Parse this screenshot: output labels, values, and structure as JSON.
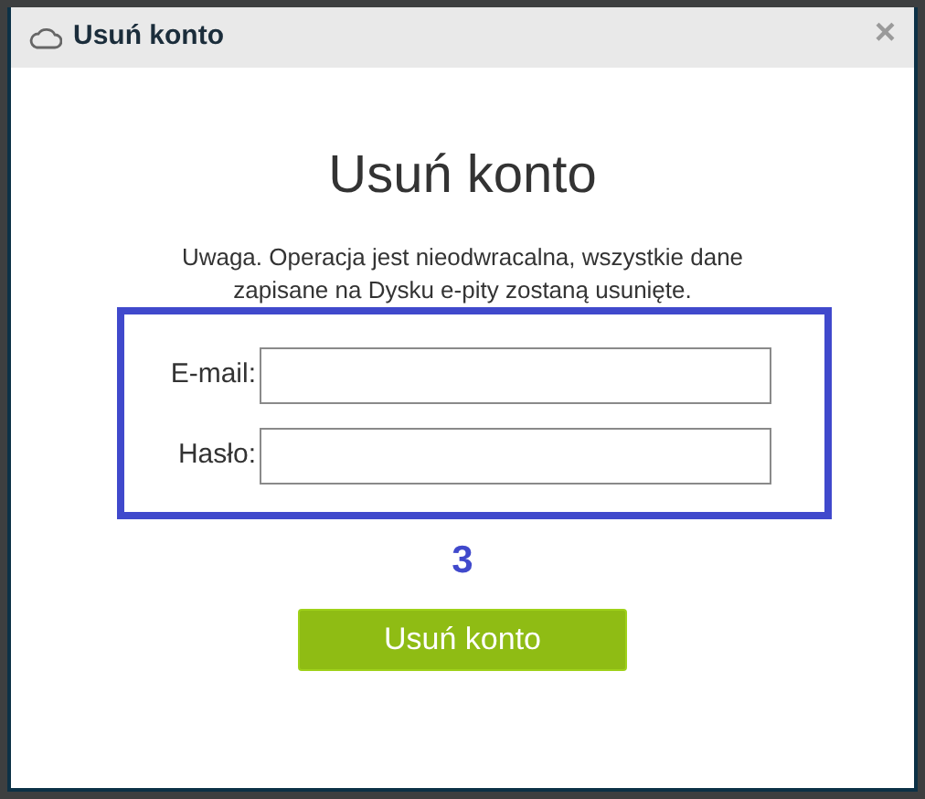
{
  "dialog": {
    "title": "Usuń konto",
    "close": "×"
  },
  "heading": "Usuń konto",
  "warning": "Uwaga. Operacja jest nieodwracalna, wszystkie dane zapisane na Dysku e-pity zostaną usunięte.",
  "fields": [
    {
      "label": "E-mail:"
    },
    {
      "label": "Hasło:"
    }
  ],
  "annotation": "3",
  "submit": "Usuń konto"
}
